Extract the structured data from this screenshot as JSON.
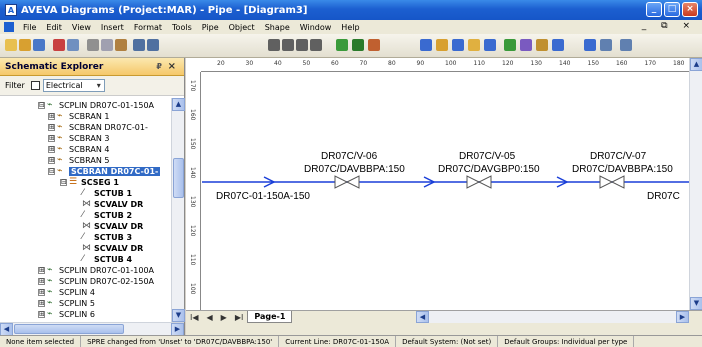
{
  "window": {
    "title": "AVEVA Diagrams (Project:MAR) - Pipe - [Diagram3]",
    "min": "_",
    "max": "□",
    "close": "×"
  },
  "menu": [
    "File",
    "Edit",
    "View",
    "Insert",
    "Format",
    "Tools",
    "Pipe",
    "Object",
    "Shape",
    "Window",
    "Help"
  ],
  "mdi_controls": "_ ⧉ ×",
  "explorer": {
    "title": "Schematic Explorer",
    "pin": "₽",
    "close": "×",
    "filter_label": "Filter",
    "filter_value": "Electrical",
    "tree": [
      {
        "label": "SCPLIN DR07C-01-150A",
        "type": "pipe",
        "expand": "⊟"
      },
      {
        "label": "SCBRAN 1",
        "type": "branch",
        "expand": "⊞"
      },
      {
        "label": "SCBRAN DR07C-01-",
        "type": "branch",
        "expand": "⊞"
      },
      {
        "label": "SCBRAN 3",
        "type": "branch",
        "expand": "⊞"
      },
      {
        "label": "SCBRAN 4",
        "type": "branch",
        "expand": "⊞"
      },
      {
        "label": "SCBRAN 5",
        "type": "branch",
        "expand": "⊞"
      },
      {
        "label": "SCBRAN DR07C-01-",
        "type": "branch",
        "expand": "⊟",
        "selected": true
      },
      {
        "label": "SCSEG 1",
        "type": "segment",
        "expand": "⊟"
      },
      {
        "label": "SCTUB 1",
        "type": "tube"
      },
      {
        "label": "SCVALV DR",
        "type": "valve"
      },
      {
        "label": "SCTUB 2",
        "type": "tube"
      },
      {
        "label": "SCVALV DR",
        "type": "valve"
      },
      {
        "label": "SCTUB 3",
        "type": "tube"
      },
      {
        "label": "SCVALV DR",
        "type": "valve"
      },
      {
        "label": "SCTUB 4",
        "type": "tube"
      },
      {
        "label": "SCPLIN DR07C-01-100A",
        "type": "pipe",
        "expand": "⊞"
      },
      {
        "label": "SCPLIN DR07C-02-150A",
        "type": "pipe",
        "expand": "⊞"
      },
      {
        "label": "SCPLIN 4",
        "type": "pipe",
        "expand": "⊞"
      },
      {
        "label": "SCPLIN 5",
        "type": "pipe",
        "expand": "⊞"
      },
      {
        "label": "SCPLIN 6",
        "type": "pipe",
        "expand": "⊞"
      }
    ]
  },
  "ruler": {
    "h_ticks": [
      "20",
      "30",
      "40",
      "50",
      "60",
      "70",
      "80",
      "90",
      "100",
      "110",
      "120",
      "130",
      "140",
      "150",
      "160",
      "170",
      "180"
    ],
    "v_ticks": [
      "170",
      "160",
      "150",
      "140",
      "130",
      "120",
      "110",
      "100"
    ]
  },
  "diagram": {
    "pipe_label": "DR07C-01-150A-150",
    "pipe_label_right": "DR07C",
    "valves": [
      {
        "name": "DR07C/V-06",
        "spec": "DR07C/DAVBBPA:150"
      },
      {
        "name": "DR07C/V-05",
        "spec": "DR07C/DAVGBP0:150"
      },
      {
        "name": "DR07C/V-07",
        "spec": "DR07C/DAVBBPA:150"
      }
    ],
    "line_color": "#1a3fd8"
  },
  "page_nav": {
    "first": "I◀",
    "prev": "◀",
    "next": "▶",
    "last": "▶I",
    "tab": "Page-1"
  },
  "status": [
    "None item selected",
    "SPRE changed from 'Unset' to 'DR07C/DAVBBPA:150'",
    "Current Line: DR07C-01-150A",
    "Default System: (Not set)",
    "Default Groups: Individual per type"
  ]
}
